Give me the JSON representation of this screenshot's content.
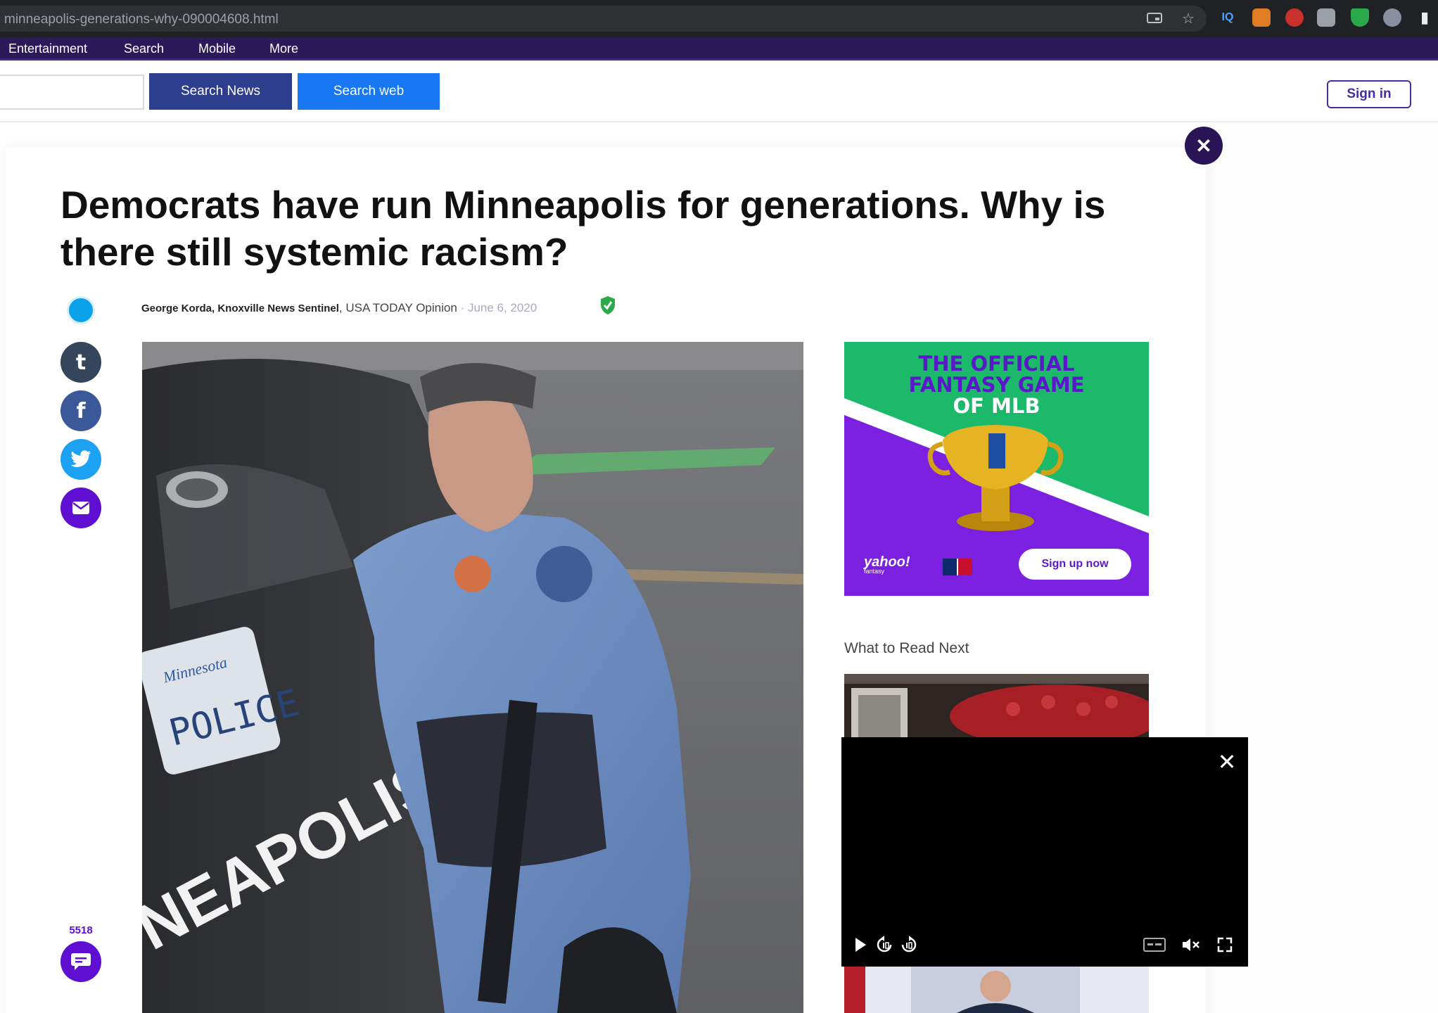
{
  "browser": {
    "url": "minneapolis-generations-why-090004608.html"
  },
  "nav": {
    "items": [
      "Entertainment",
      "Search",
      "Mobile",
      "More"
    ]
  },
  "search": {
    "news_label": "Search News",
    "web_label": "Search web"
  },
  "header": {
    "sign_in_label": "Sign in"
  },
  "article": {
    "headline": "Democrats have run Minneapolis for generations. Why is there still systemic racism?",
    "author": "George Korda, Knoxville News Sentinel",
    "outlet": "USA TODAY Opinion",
    "separator": "·",
    "date": "June 6, 2020",
    "comment_count": "5518",
    "photo": {
      "plate_text": "POLICE",
      "plate_state": "Minnesota",
      "vehicle_text": "NEAPOLIS"
    }
  },
  "share": {
    "icons": [
      "tumblr-icon",
      "facebook-icon",
      "twitter-icon",
      "mail-icon"
    ]
  },
  "ad": {
    "title_lines": [
      "THE OFFICIAL",
      "FANTASY GAME",
      "OF MLB"
    ],
    "cta_label": "Sign up now",
    "brand": "yahoo!",
    "brand_sub": "fantasy"
  },
  "sidebar": {
    "read_next_label": "What to Read Next"
  },
  "colors": {
    "nav_purple": "#2b1a5a",
    "search_news_blue": "#2d3e8f",
    "search_web_blue": "#1877f2",
    "accent_purple": "#5f0fd1",
    "ad_green": "#1db96b",
    "ad_purple": "#7b1fe0"
  }
}
